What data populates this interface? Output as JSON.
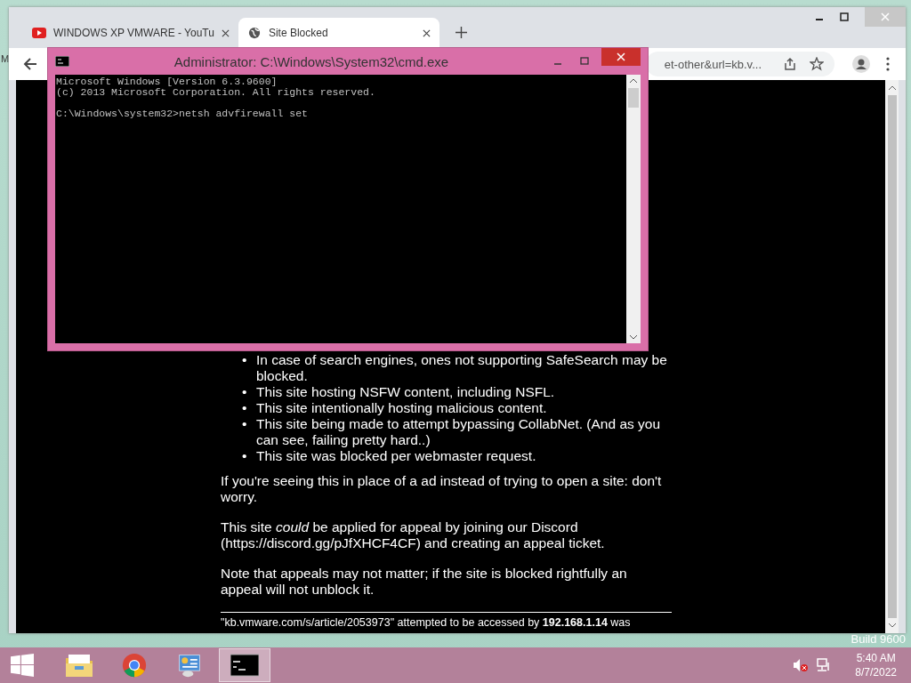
{
  "desktop": {
    "icon_label_fragment": "M",
    "watermark": "Build 9600"
  },
  "browser": {
    "tabs": [
      {
        "title": "WINDOWS XP VMWARE - YouTu",
        "kind": "video",
        "selected": false
      },
      {
        "title": "Site Blocked",
        "kind": "web",
        "selected": true
      }
    ],
    "address_fragment": "et-other&url=kb.v...",
    "page": {
      "list_items": [
        {
          "bullet": "•",
          "text": "In case of search engines, ones not supporting SafeSearch may be blocked."
        },
        {
          "bullet": "•",
          "text": "This site hosting NSFW content, including NSFL."
        },
        {
          "bullet": "•",
          "text": "This site intentionally hosting malicious content."
        },
        {
          "bullet": "•",
          "text": "This site being made to attempt bypassing CollabNet. (And as you can see, failing pretty hard..)"
        },
        {
          "bullet": "•",
          "text": "This site was blocked per webmaster request."
        }
      ],
      "paragraphs": [
        "If you're seeing this in place of a ad instead of trying to open a site: don't worry.",
        "This site *could* be applied for appeal by joining our Discord (https://discord.gg/pJfXHCF4CF) and creating an appeal ticket.",
        "Note that appeals may not matter; if the site is blocked rightfully an appeal will not unblock it."
      ],
      "footer": "\"kb.vmware.com/s/article/2053973\" attempted to be accessed by **192.168.1.14** was"
    }
  },
  "console": {
    "title": "Administrator: C:\\Windows\\System32\\cmd.exe",
    "blocks": [
      [
        "Microsoft Windows [Version 6.3.9600]",
        "(c) 2013 Microsoft Corporation. All rights reserved."
      ],
      [
        "C:\\Windows\\system32>netsh advfirewall set"
      ]
    ]
  },
  "taskbar": {
    "apps": [
      {
        "kind": "explorer",
        "selected": false
      },
      {
        "kind": "browser",
        "selected": false
      },
      {
        "kind": "control",
        "selected": false
      },
      {
        "kind": "cmd",
        "selected": true
      }
    ],
    "clock": {
      "time": "5:40 AM",
      "date": "8/7/2022"
    }
  }
}
